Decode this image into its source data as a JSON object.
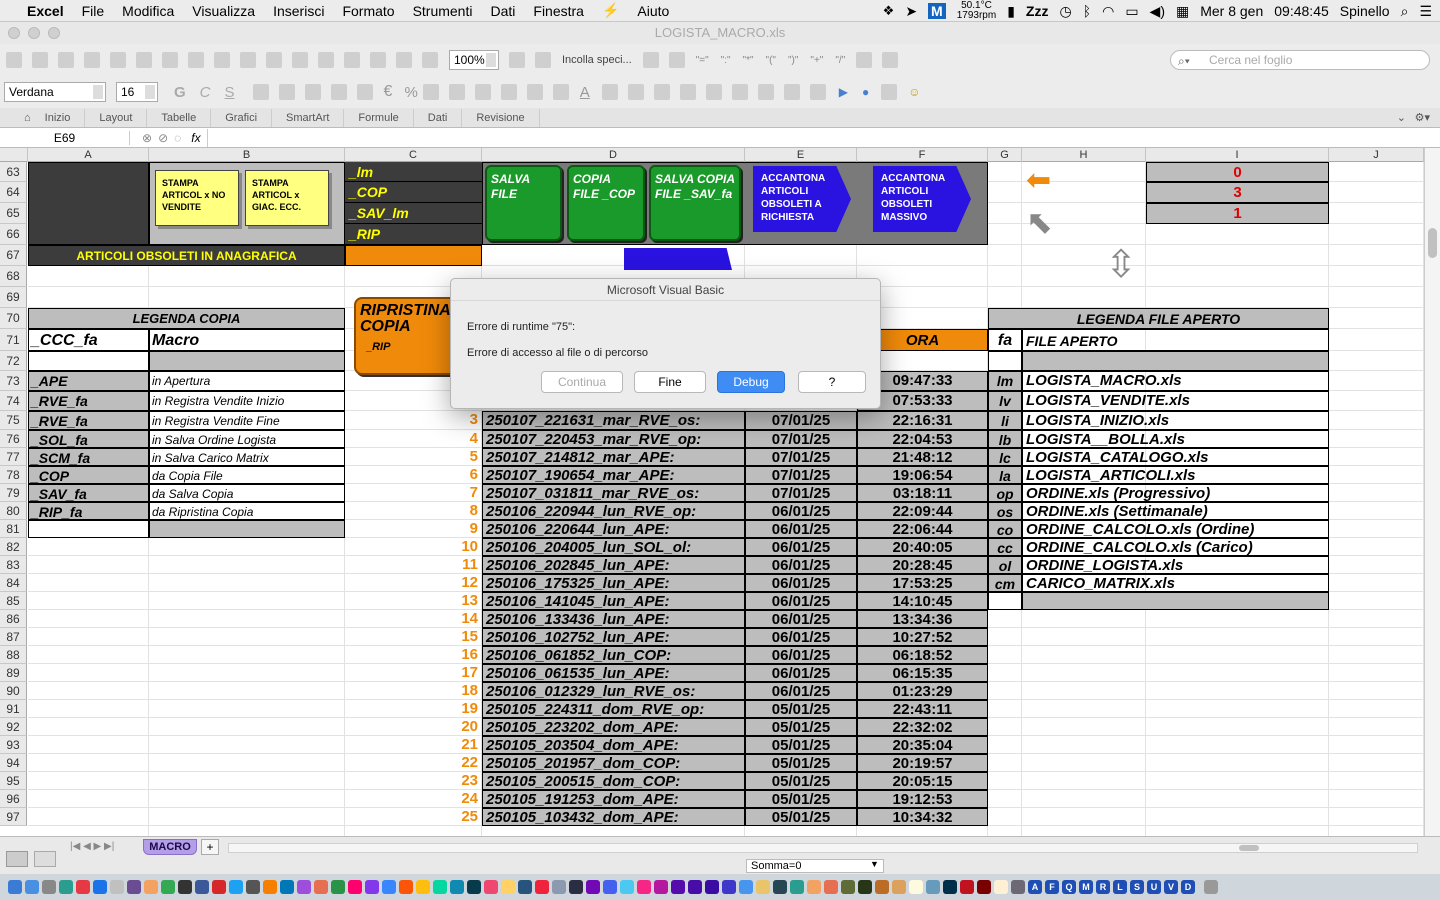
{
  "menubar": {
    "app": "Excel",
    "items": [
      "File",
      "Modifica",
      "Visualizza",
      "Inserisci",
      "Formato",
      "Strumenti",
      "Dati",
      "Finestra",
      "Aiuto"
    ],
    "cpu_temp": "50.1°C",
    "cpu_rpm": "1793rpm",
    "zzz": "Zzz",
    "date": "Mer 8 gen",
    "time": "09:48:45",
    "user": "Spinello"
  },
  "window": {
    "title": "LOGISTA_MACRO.xls"
  },
  "toolbar": {
    "zoom": "100%",
    "paste_special": "Incolla speci...",
    "search_placeholder": "Cerca nel foglio",
    "font_name": "Verdana",
    "font_size": "16",
    "symbols": [
      "\"=\"",
      "\":\"",
      "\"*\"",
      "\"(\"",
      "\")\"",
      "\"+\"",
      "\"/\""
    ]
  },
  "ribbon": {
    "tabs": [
      "Inizio",
      "Layout",
      "Tabelle",
      "Grafici",
      "SmartArt",
      "Formule",
      "Dati",
      "Revisione"
    ]
  },
  "formula": {
    "name_box": "E69",
    "fx": "fx"
  },
  "columns": [
    "A",
    "B",
    "C",
    "D",
    "E",
    "F",
    "G",
    "H",
    "I",
    "J"
  ],
  "rows": [
    "63",
    "64",
    "65",
    "66",
    "67",
    "68",
    "69",
    "70",
    "71",
    "72",
    "73",
    "74",
    "75",
    "76",
    "77",
    "78",
    "79",
    "80",
    "81",
    "82",
    "83",
    "84",
    "85",
    "86",
    "87",
    "88",
    "89",
    "90",
    "91",
    "92",
    "93",
    "94",
    "95",
    "96",
    "97"
  ],
  "sheet": {
    "print_btns": [
      "STAMPA ARTICOL x NO VENDITE",
      "STAMPA ARTICOL x GIAC. ECC."
    ],
    "macro_c": [
      "_lm",
      "_COP",
      "_SAV_lm",
      "_RIP"
    ],
    "green_btns": [
      "SALVA FILE",
      "COPIA FILE _COP",
      "SALVA COPIA FILE _SAV_fa"
    ],
    "blue_btns": [
      "ACCANTONA ARTICOLI OBSOLETI A RICHIESTA",
      "ACCANTONA ARTICOLI OBSOLETI MASSIVO"
    ],
    "counters": [
      "0",
      "3",
      "1"
    ],
    "obsolete_title": "ARTICOLI OBSOLETI IN ANAGRAFICA",
    "ripristina": "RIPRISTINA COPIA",
    "ripristina_sub": "_RIP",
    "legenda_copia_title": "LEGENDA COPIA",
    "legenda_copia_head": [
      "_CCC_fa",
      "Macro"
    ],
    "legenda_copia": [
      [
        "_APE",
        "in Apertura"
      ],
      [
        "_RVE_fa",
        "in Registra Vendite Inizio"
      ],
      [
        "_RVE_fa",
        "in Registra Vendite Fine"
      ],
      [
        "_SOL_fa",
        "in Salva Ordine Logista"
      ],
      [
        "_SCM_fa",
        "in Salva Carico Matrix"
      ],
      [
        "_COP",
        "da Copia File"
      ],
      [
        "_SAV_fa",
        "da Salva        Copia"
      ],
      [
        "_RIP_fa",
        "da Ripristina Copia"
      ]
    ],
    "ora_header": "ORA",
    "log_rows": [
      [
        "",
        "",
        "",
        "09:47:33"
      ],
      [
        "",
        "",
        "",
        "07:53:33"
      ],
      [
        "3",
        "250107_221631_mar_RVE_os:",
        "07/01/25",
        "22:16:31"
      ],
      [
        "4",
        "250107_220453_mar_RVE_op:",
        "07/01/25",
        "22:04:53"
      ],
      [
        "5",
        "250107_214812_mar_APE:",
        "07/01/25",
        "21:48:12"
      ],
      [
        "6",
        "250107_190654_mar_APE:",
        "07/01/25",
        "19:06:54"
      ],
      [
        "7",
        "250107_031811_mar_RVE_os:",
        "07/01/25",
        "03:18:11"
      ],
      [
        "8",
        "250106_220944_lun_RVE_op:",
        "06/01/25",
        "22:09:44"
      ],
      [
        "9",
        "250106_220644_lun_APE:",
        "06/01/25",
        "22:06:44"
      ],
      [
        "10",
        "250106_204005_lun_SOL_ol:",
        "06/01/25",
        "20:40:05"
      ],
      [
        "11",
        "250106_202845_lun_APE:",
        "06/01/25",
        "20:28:45"
      ],
      [
        "12",
        "250106_175325_lun_APE:",
        "06/01/25",
        "17:53:25"
      ],
      [
        "13",
        "250106_141045_lun_APE:",
        "06/01/25",
        "14:10:45"
      ],
      [
        "14",
        "250106_133436_lun_APE:",
        "06/01/25",
        "13:34:36"
      ],
      [
        "15",
        "250106_102752_lun_APE:",
        "06/01/25",
        "10:27:52"
      ],
      [
        "16",
        "250106_061852_lun_COP:",
        "06/01/25",
        "06:18:52"
      ],
      [
        "17",
        "250106_061535_lun_APE:",
        "06/01/25",
        "06:15:35"
      ],
      [
        "18",
        "250106_012329_lun_RVE_os:",
        "06/01/25",
        "01:23:29"
      ],
      [
        "19",
        "250105_224311_dom_RVE_op:",
        "05/01/25",
        "22:43:11"
      ],
      [
        "20",
        "250105_223202_dom_APE:",
        "05/01/25",
        "22:32:02"
      ],
      [
        "21",
        "250105_203504_dom_APE:",
        "05/01/25",
        "20:35:04"
      ],
      [
        "22",
        "250105_201957_dom_COP:",
        "05/01/25",
        "20:19:57"
      ],
      [
        "23",
        "250105_200515_dom_COP:",
        "05/01/25",
        "20:05:15"
      ],
      [
        "24",
        "250105_191253_dom_APE:",
        "05/01/25",
        "19:12:53"
      ],
      [
        "25",
        "250105_103432_dom_APE:",
        "05/01/25",
        "10:34:32"
      ]
    ],
    "legenda_file_title": "LEGENDA FILE APERTO",
    "legenda_file_head": [
      "fa",
      "FILE APERTO"
    ],
    "legenda_file": [
      [
        "lm",
        "LOGISTA_MACRO.xls"
      ],
      [
        "lv",
        "LOGISTA_VENDITE.xls"
      ],
      [
        "li",
        "LOGISTA_INIZIO.xls"
      ],
      [
        "lb",
        "LOGISTA__BOLLA.xls"
      ],
      [
        "lc",
        "LOGISTA_CATALOGO.xls"
      ],
      [
        "la",
        "LOGISTA_ARTICOLI.xls"
      ],
      [
        "op",
        "ORDINE.xls (Progressivo)"
      ],
      [
        "os",
        "ORDINE.xls (Settimanale)"
      ],
      [
        "co",
        "ORDINE_CALCOLO.xls (Ordine)"
      ],
      [
        "cc",
        "ORDINE_CALCOLO.xls (Carico)"
      ],
      [
        "ol",
        "ORDINE_LOGISTA.xls"
      ],
      [
        "cm",
        "CARICO_MATRIX.xls"
      ]
    ]
  },
  "dialog": {
    "title": "Microsoft Visual Basic",
    "line1": "Errore di runtime \"75\":",
    "line2": "Errore di accesso al file o di percorso",
    "buttons": [
      "Continua",
      "Fine",
      "Debug",
      "?"
    ]
  },
  "status": {
    "sheet_tab": "MACRO",
    "add": "+",
    "summary": "Somma=0"
  },
  "dock_letters": [
    "A",
    "F",
    "Q",
    "M",
    "R",
    "L",
    "S",
    "U",
    "V",
    "D"
  ],
  "colors": {
    "orange": "#f08a0a",
    "green": "#1a9a2a",
    "blue": "#2a12e0",
    "gray": "#bdbdbd",
    "dark": "#3c3c3c",
    "red": "#e00000",
    "yellow": "#ffff80"
  }
}
